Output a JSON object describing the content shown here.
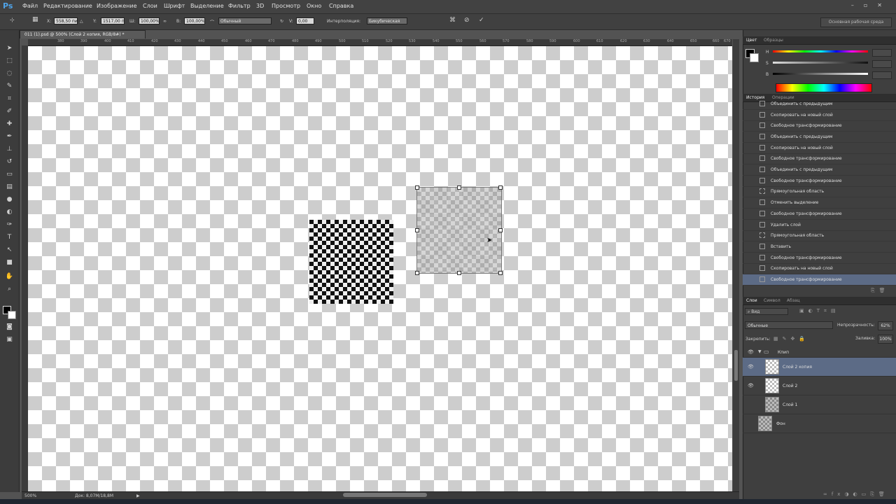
{
  "app": {
    "logo": "Ps"
  },
  "menu": {
    "items": [
      "Файл",
      "Редактирование",
      "Изображение",
      "Слои",
      "Шрифт",
      "Выделение",
      "Фильтр",
      "3D",
      "Просмотр",
      "Окно",
      "Справка"
    ]
  },
  "options": {
    "x_label": "X:",
    "x_value": "558,50 пи",
    "y_label": "Y:",
    "y_value": "1517,00 п",
    "w_label": "Ш:",
    "w_value": "100,00%",
    "h_label": "В:",
    "h_value": "100,00%",
    "warp_mode": "Обычный",
    "v_label": "V:",
    "v_value": "0,00",
    "interp_label": "Интерполяция:",
    "interp_value": "Бикубическая",
    "workspace": "Основная рабочая среда"
  },
  "document": {
    "tab_title": "011 (1).psd @ 500% (Слой 2 копия, RGB/8#) *"
  },
  "ruler": {
    "ticks": [
      "380",
      "390",
      "400",
      "410",
      "420",
      "430",
      "440",
      "450",
      "460",
      "470",
      "480",
      "490",
      "500",
      "510",
      "520",
      "530",
      "540",
      "550",
      "560",
      "570",
      "580",
      "590",
      "600",
      "610",
      "620",
      "630",
      "640",
      "650",
      "660",
      "670"
    ]
  },
  "status": {
    "zoom": "500%",
    "doc_info": "Док: 8,07M/18,8M"
  },
  "color_panel": {
    "tabs": [
      "Цвет",
      "Образцы"
    ],
    "labels": [
      "H",
      "S",
      "B"
    ],
    "colors": {
      "foreground": "#000000",
      "background": "#ffffff"
    }
  },
  "history_panel": {
    "tabs": [
      "История",
      "Операции"
    ],
    "items": [
      "Объединить с предыдущим",
      "Скопировать на новый слой",
      "Свободное трансформирование",
      "Объединить с предыдущим",
      "Скопировать на новый слой",
      "Свободное трансформирование",
      "Объединить с предыдущим",
      "Свободное трансформирование",
      "Прямоугольная область",
      "Отменить выделение",
      "Свободное трансформирование",
      "Удалить слой",
      "Прямоугольная область",
      "Вставить",
      "Свободное трансформирование",
      "Скопировать на новый слой",
      "Свободное трансформирование"
    ]
  },
  "layers_panel": {
    "tabs": [
      "Слои",
      "Символ",
      "Абзац"
    ],
    "filter": "Вид",
    "blend_mode": "Обычные",
    "opacity_label": "Непрозрачность:",
    "opacity_value": "62%",
    "lock_label": "Закрепить:",
    "fill_label": "Заливка:",
    "fill_value": "100%",
    "group_name": "Кпип",
    "layers": [
      "Слой 2 копия",
      "Слой 2",
      "Слой 1",
      "Фон"
    ]
  }
}
